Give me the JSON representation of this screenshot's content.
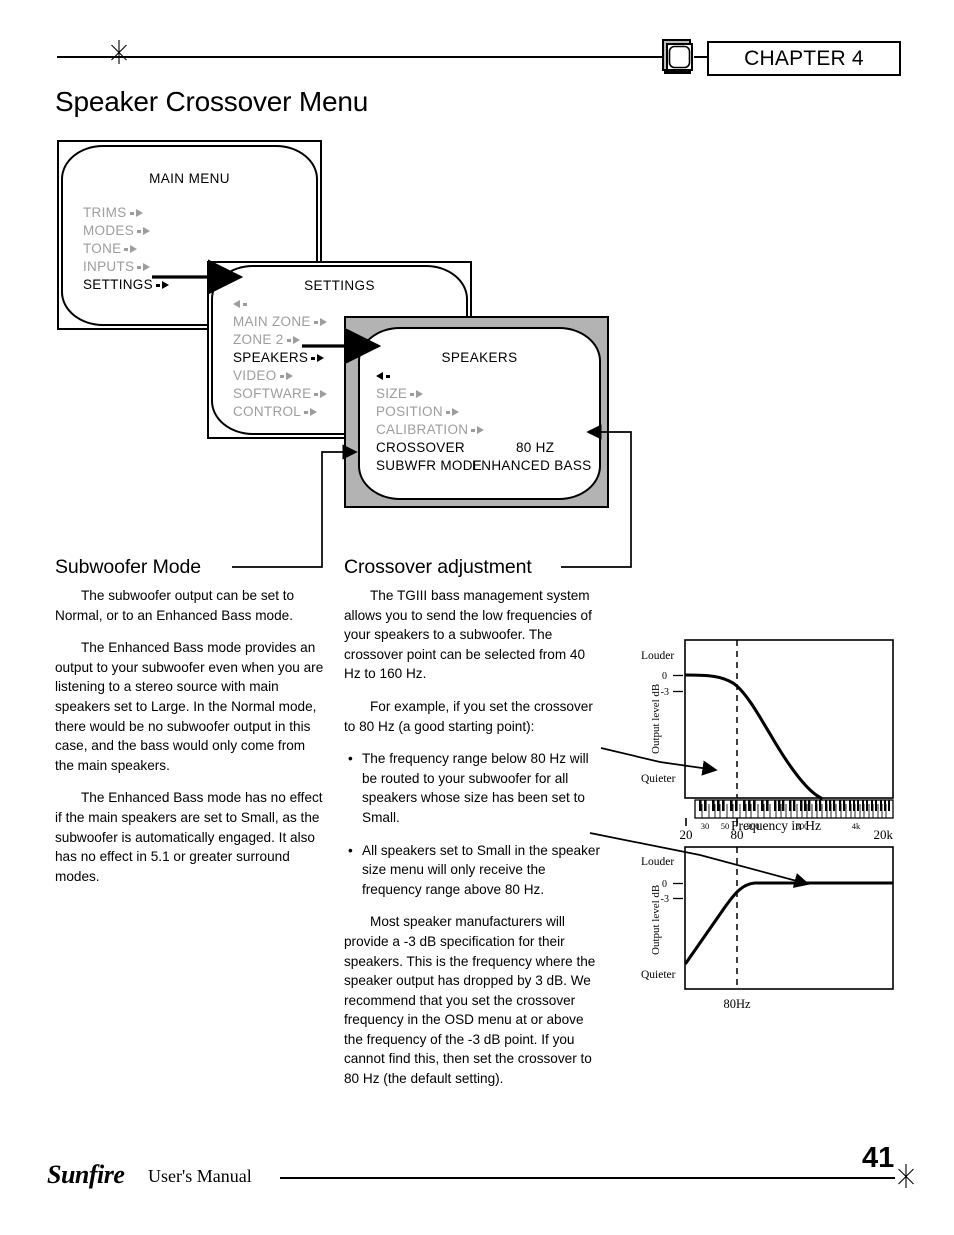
{
  "header": {
    "chapter_label": "CHAPTER 4",
    "tv_icon": "tv-monitor-icon",
    "star_icon": "asterisk-ornament-icon"
  },
  "page_title": "Speaker Crossover Menu",
  "osd": {
    "main_menu": {
      "title": "MAIN MENU",
      "items": [
        {
          "label": "TRIMS",
          "state": "dim"
        },
        {
          "label": "MODES",
          "state": "dim"
        },
        {
          "label": "TONE",
          "state": "dim"
        },
        {
          "label": "INPUTS",
          "state": "dim"
        },
        {
          "label": "SETTINGS",
          "state": "selected"
        }
      ]
    },
    "settings_menu": {
      "title": "SETTINGS",
      "back_arrow": "back-arrow-icon",
      "items": [
        {
          "label": "MAIN ZONE",
          "state": "dim"
        },
        {
          "label": "ZONE 2",
          "state": "dim"
        },
        {
          "label": "SPEAKERS",
          "state": "selected"
        },
        {
          "label": "VIDEO",
          "state": "dim"
        },
        {
          "label": "SOFTWARE",
          "state": "dim"
        },
        {
          "label": "CONTROL",
          "state": "dim"
        }
      ]
    },
    "speakers_menu": {
      "title": "SPEAKERS",
      "back_arrow": "back-arrow-icon",
      "items": [
        {
          "label": "SIZE",
          "state": "dim",
          "value": ""
        },
        {
          "label": "POSITION",
          "state": "dim",
          "value": ""
        },
        {
          "label": "CALIBRATION",
          "state": "dim",
          "value": ""
        },
        {
          "label": "CROSSOVER",
          "state": "selected",
          "value": "80  HZ"
        },
        {
          "label": "SUBWFR MODE",
          "state": "selected",
          "value": "ENHANCED BASS"
        }
      ]
    }
  },
  "sections": {
    "subwoofer_mode": {
      "heading": "Subwoofer Mode",
      "paragraphs": [
        "The subwoofer output can be set to Normal, or to an Enhanced Bass mode.",
        "The Enhanced Bass mode provides an output to your subwoofer even when you are listening to a stereo source with main speakers set to Large. In the Normal mode, there would be no subwoofer output in this case, and the bass would only come from the main speakers.",
        "The Enhanced Bass mode has no effect if the main speakers are set to Small, as the subwoofer is automatically engaged. It also has no effect in 5.1 or greater surround modes."
      ]
    },
    "crossover_adjustment": {
      "heading": "Crossover adjustment",
      "paragraphs_before": [
        "The TGIII bass management system allows you to send the low frequencies of your speakers to a subwoofer. The crossover point can be selected from 40 Hz to 160 Hz.",
        "For example, if you set the crossover to 80 Hz (a good starting point):"
      ],
      "bullets": [
        "The frequency range below 80 Hz will be routed to your subwoofer for all speakers whose size has been set to Small.",
        "All speakers set to Small in the speaker size menu will only receive the frequency range above 80 Hz."
      ],
      "paragraphs_after": [
        "Most speaker manufacturers will provide a -3 dB specification for their speakers. This is the frequency where the speaker output has dropped by 3 dB. We recommend that you set the crossover frequency in the OSD menu at or above the frequency of the -3 dB point. If you cannot find this, then set the crossover to 80 Hz (the default setting)."
      ]
    }
  },
  "chart_data": [
    {
      "type": "line",
      "id": "lowpass",
      "title": "",
      "xlabel": "Frequency  in  Hz",
      "ylabel": "Output  level  dB",
      "y_top_label": "Louder",
      "y_bottom_label": "Quieter",
      "ytick_labels": [
        "0",
        "-3"
      ],
      "xtick_labels": [
        "20",
        "20k"
      ],
      "keyboard_tick_labels": [
        "30",
        "50",
        "80",
        "200",
        "800",
        "4k"
      ],
      "marker_line": "80",
      "grid": false,
      "legend": "none",
      "x": [
        20,
        40,
        60,
        80,
        110,
        160,
        250,
        400,
        700,
        1200
      ],
      "y": [
        0,
        0,
        -0.6,
        -3,
        -7,
        -12,
        -18,
        -24,
        -30,
        -34
      ],
      "ylim": [
        -34,
        3
      ],
      "xlim_log": [
        20,
        20000
      ],
      "note": "Low-pass response sent to the subwoofer; -3 dB at the 80 Hz crossover point"
    },
    {
      "type": "line",
      "id": "highpass",
      "title": "",
      "xlabel": "80Hz",
      "ylabel": "Output  level  dB",
      "y_top_label": "Louder",
      "y_bottom_label": "Quieter",
      "ytick_labels": [
        "0",
        "-3"
      ],
      "xtick_labels": [],
      "marker_line": "80Hz",
      "grid": false,
      "legend": "none",
      "x": [
        20,
        35,
        55,
        80,
        110,
        160,
        300,
        1000,
        20000
      ],
      "y": [
        -30,
        -21,
        -11,
        -3,
        -0.8,
        -0.1,
        0,
        0,
        0
      ],
      "ylim": [
        -30,
        3
      ],
      "note": "High-pass response sent to speakers set to Small; -3 dB at the 80 Hz crossover point"
    }
  ],
  "footer": {
    "brand": "Sunfire",
    "manual_label": "User's Manual",
    "page_number": "41",
    "star_icon": "asterisk-ornament-icon"
  }
}
